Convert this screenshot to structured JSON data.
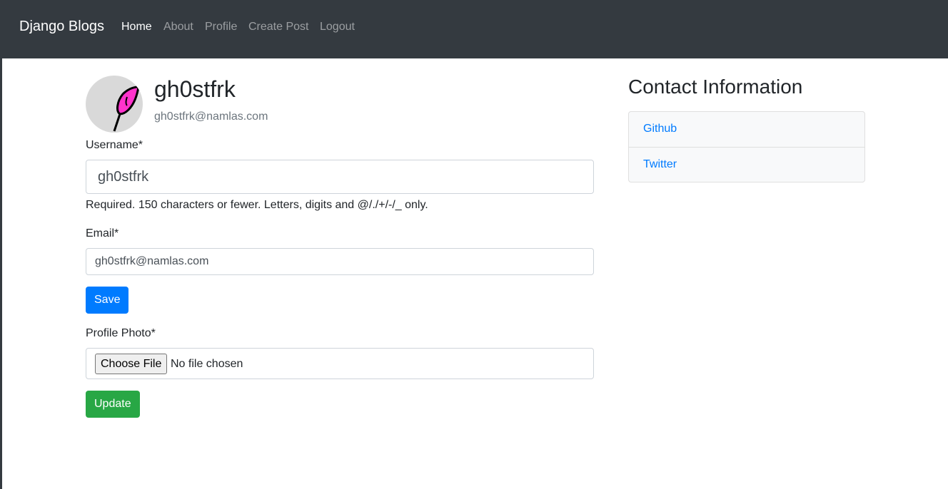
{
  "navbar": {
    "brand": "Django Blogs",
    "links": [
      {
        "label": "Home",
        "active": true
      },
      {
        "label": "About",
        "active": false
      },
      {
        "label": "Profile",
        "active": false
      },
      {
        "label": "Create Post",
        "active": false
      },
      {
        "label": "Logout",
        "active": false
      }
    ]
  },
  "profile": {
    "username": "gh0stfrk",
    "email": "gh0stfrk@namlas.com",
    "avatar_icon": "feather-icon"
  },
  "form": {
    "username_label": "Username*",
    "username_value": "gh0stfrk",
    "username_help": "Required. 150 characters or fewer. Letters, digits and @/./+/-/_ only.",
    "email_label": "Email*",
    "email_value": "gh0stfrk@namlas.com",
    "save_label": "Save",
    "photo_label": "Profile Photo*",
    "choose_file_label": "Choose File",
    "file_status": "No file chosen",
    "update_label": "Update"
  },
  "contact": {
    "title": "Contact Information",
    "links": [
      "Github",
      "Twitter"
    ]
  },
  "colors": {
    "navbar_bg": "#343a40",
    "primary": "#007bff",
    "success": "#28a745",
    "avatar_accent": "#ff33cc"
  }
}
